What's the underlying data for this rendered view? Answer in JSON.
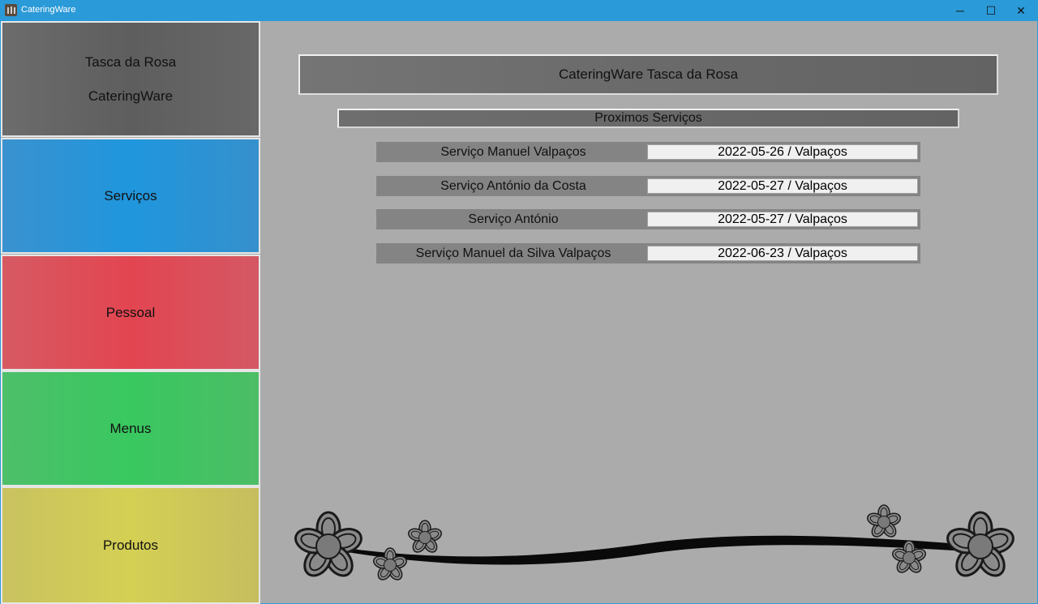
{
  "window": {
    "title": "CateringWare",
    "minimize_glyph": "─",
    "maximize_glyph": "☐",
    "close_glyph": "✕"
  },
  "sidebar": {
    "header_line1": "Tasca da Rosa",
    "header_line2": "CateringWare",
    "items": [
      {
        "label": "Serviços",
        "color": "#1f96dd"
      },
      {
        "label": "Pessoal",
        "color": "#e24550"
      },
      {
        "label": "Menus",
        "color": "#39c860"
      },
      {
        "label": "Produtos",
        "color": "#d4d054"
      }
    ]
  },
  "main": {
    "banner": "CateringWare Tasca da Rosa",
    "section_title": "Proximos Serviços",
    "services": [
      {
        "name": "Serviço Manuel Valpaços",
        "date_location": "2022-05-26 / Valpaços"
      },
      {
        "name": "Serviço António da Costa",
        "date_location": "2022-05-27 / Valpaços"
      },
      {
        "name": "Serviço António",
        "date_location": "2022-05-27 / Valpaços"
      },
      {
        "name": "Serviço Manuel da Silva Valpaços",
        "date_location": "2022-06-23 / Valpaços"
      }
    ]
  },
  "decoration": {
    "icon": "flower-vine-ornament"
  }
}
